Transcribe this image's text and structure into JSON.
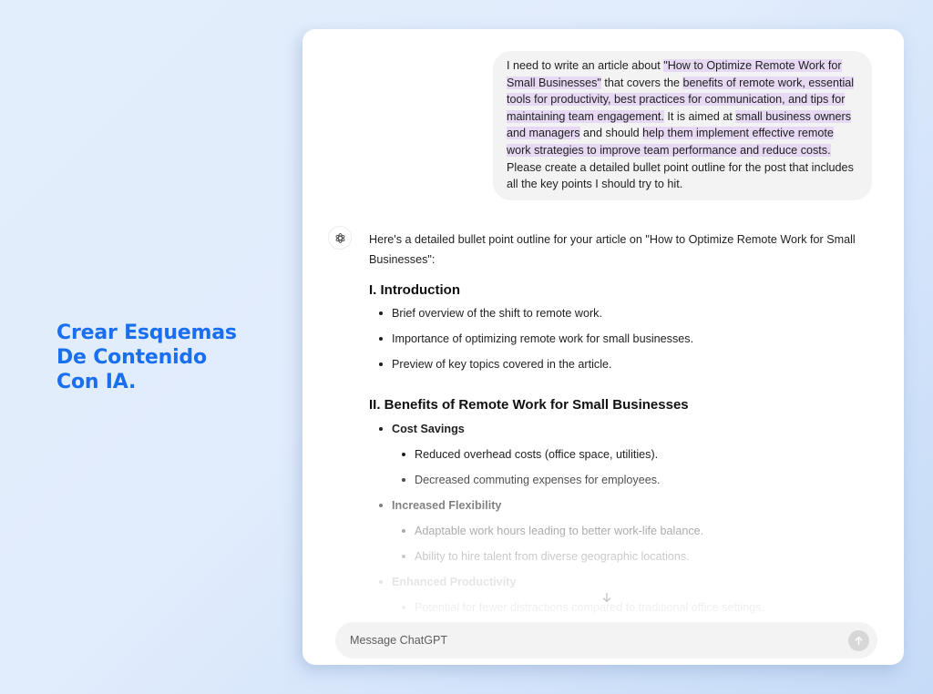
{
  "headline": {
    "lines": [
      "Crear Esquemas",
      "De Contenido",
      "Con IA."
    ],
    "color": "#1a6ff0"
  },
  "chat": {
    "user_message": {
      "segments": [
        {
          "text": "I need to write an article about ",
          "highlight": false
        },
        {
          "text": "\"How to Optimize Remote Work for Small Businesses\"",
          "highlight": true
        },
        {
          "text": " that covers the ",
          "highlight": false
        },
        {
          "text": "benefits of remote work, essential tools for productivity, best practices for communication, and tips for maintaining team engagement.",
          "highlight": true
        },
        {
          "text": " It is aimed at ",
          "highlight": false
        },
        {
          "text": "small business owners and managers",
          "highlight": true
        },
        {
          "text": " and should ",
          "highlight": false
        },
        {
          "text": "help them implement effective remote work strategies to improve team performance and reduce costs.",
          "highlight": true
        },
        {
          "text": " Please create a detailed bullet point outline for the post that includes all the key points I should try to hit.",
          "highlight": false
        }
      ],
      "highlight_color": "#e7d8f3"
    },
    "assistant": {
      "avatar_icon": "openai-logo-icon",
      "intro": "Here's a detailed bullet point outline for your article on \"How to Optimize Remote Work for Small Businesses\":",
      "sections": [
        {
          "title": "I. Introduction",
          "items": [
            {
              "text": "Brief overview of the shift to remote work."
            },
            {
              "text": "Importance of optimizing remote work for small businesses."
            },
            {
              "text": "Preview of key topics covered in the article."
            }
          ]
        },
        {
          "title": "II. Benefits of Remote Work for Small Businesses",
          "groups": [
            {
              "label": "Cost Savings",
              "items": [
                "Reduced overhead costs (office space, utilities).",
                "Decreased commuting expenses for employees."
              ]
            },
            {
              "label": "Increased Flexibility",
              "items": [
                "Adaptable work hours leading to better work-life balance.",
                "Ability to hire talent from diverse geographic locations."
              ]
            },
            {
              "label": "Enhanced Productivity",
              "items": [
                "Potential for fewer distractions compared to traditional office settings."
              ]
            }
          ]
        }
      ]
    },
    "scroll_down_icon": "arrow-down-icon",
    "composer": {
      "placeholder": "Message ChatGPT",
      "value": "",
      "send_icon": "arrow-up-icon"
    }
  }
}
